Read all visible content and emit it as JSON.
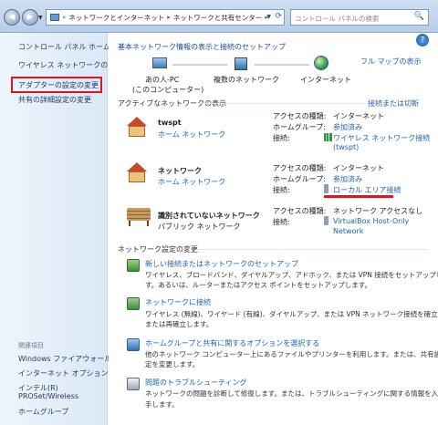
{
  "address": {
    "segments": [
      "ネットワークとインターネット",
      "ネットワークと共有センター"
    ],
    "prefix": "«",
    "search_placeholder": "コントロール パネルの検索"
  },
  "sidebar": {
    "items": [
      "コントロール パネル ホーム",
      "ワイヤレス ネットワークの管理",
      "アダプターの設定の変更",
      "共有の詳細設定の変更"
    ],
    "see_also_title": "関連項目",
    "see_also": [
      "Windows ファイアウォール",
      "インターネット オプション",
      "インテル(R)",
      "PROSet/Wireless",
      "ホームグループ"
    ]
  },
  "main": {
    "heading": "基本ネットワーク情報の表示と接続のセットアップ",
    "full_map": "フル マップの表示",
    "map": {
      "pc_label": "あの人-PC",
      "pc_sub": "(このコンピューター)",
      "multi_label": "複数のネットワーク",
      "internet_label": "インターネット"
    },
    "active_title": "アクティブなネットワークの表示",
    "connect_disconnect": "接続または切断",
    "networks": [
      {
        "name": "twspt",
        "type": "ホーム ネットワーク",
        "access_label": "アクセスの種類:",
        "access_value": "インターネット",
        "hg_label": "ホームグループ:",
        "hg_value": "参加済み",
        "conn_label": "接続:",
        "conn_value": "ワイヤレス ネットワーク接続",
        "conn_value2": "(twspt)"
      },
      {
        "name": "ネットワーク",
        "type": "ホーム ネットワーク",
        "access_label": "アクセスの種類:",
        "access_value": "インターネット",
        "hg_label": "ホームグループ:",
        "hg_value": "参加済み",
        "conn_label": "接続:",
        "conn_value": "ローカル エリア接続"
      },
      {
        "name": "識別されていないネットワーク",
        "type": "パブリック ネットワーク",
        "access_label": "アクセスの種類:",
        "access_value": "ネットワーク アクセスなし",
        "conn_label": "接続:",
        "conn_value": "VirtualBox Host-Only",
        "conn_value2": "Network"
      }
    ],
    "settings_title": "ネットワーク設定の変更",
    "tasks": [
      {
        "title": "新しい接続またはネットワークのセットアップ",
        "desc1": "ワイヤレス、ブロードバンド、ダイヤルアップ、アドホック、または VPN 接続をセットアップしま",
        "desc2": "す。あるいは、ルーターまたはアクセス ポイントをセットアップします。"
      },
      {
        "title": "ネットワークに接続",
        "desc1": "ワイヤレス (無線)、ワイヤード (有線)、ダイヤルアップ、または VPN ネットワーク接続を確立",
        "desc2": "または再確立します。"
      },
      {
        "title": "ホームグループと共有に関するオプションを選択する",
        "desc1": "他のネットワーク コンピューター上にあるファイルやプリンターを利用します。または、共有設",
        "desc2": "定を変更します。"
      },
      {
        "title": "問題のトラブルシューティング",
        "desc1": "ネットワークの問題を診断して修復します。または、トラブルシューティングに関する情報を入",
        "desc2": "手します。"
      }
    ]
  }
}
